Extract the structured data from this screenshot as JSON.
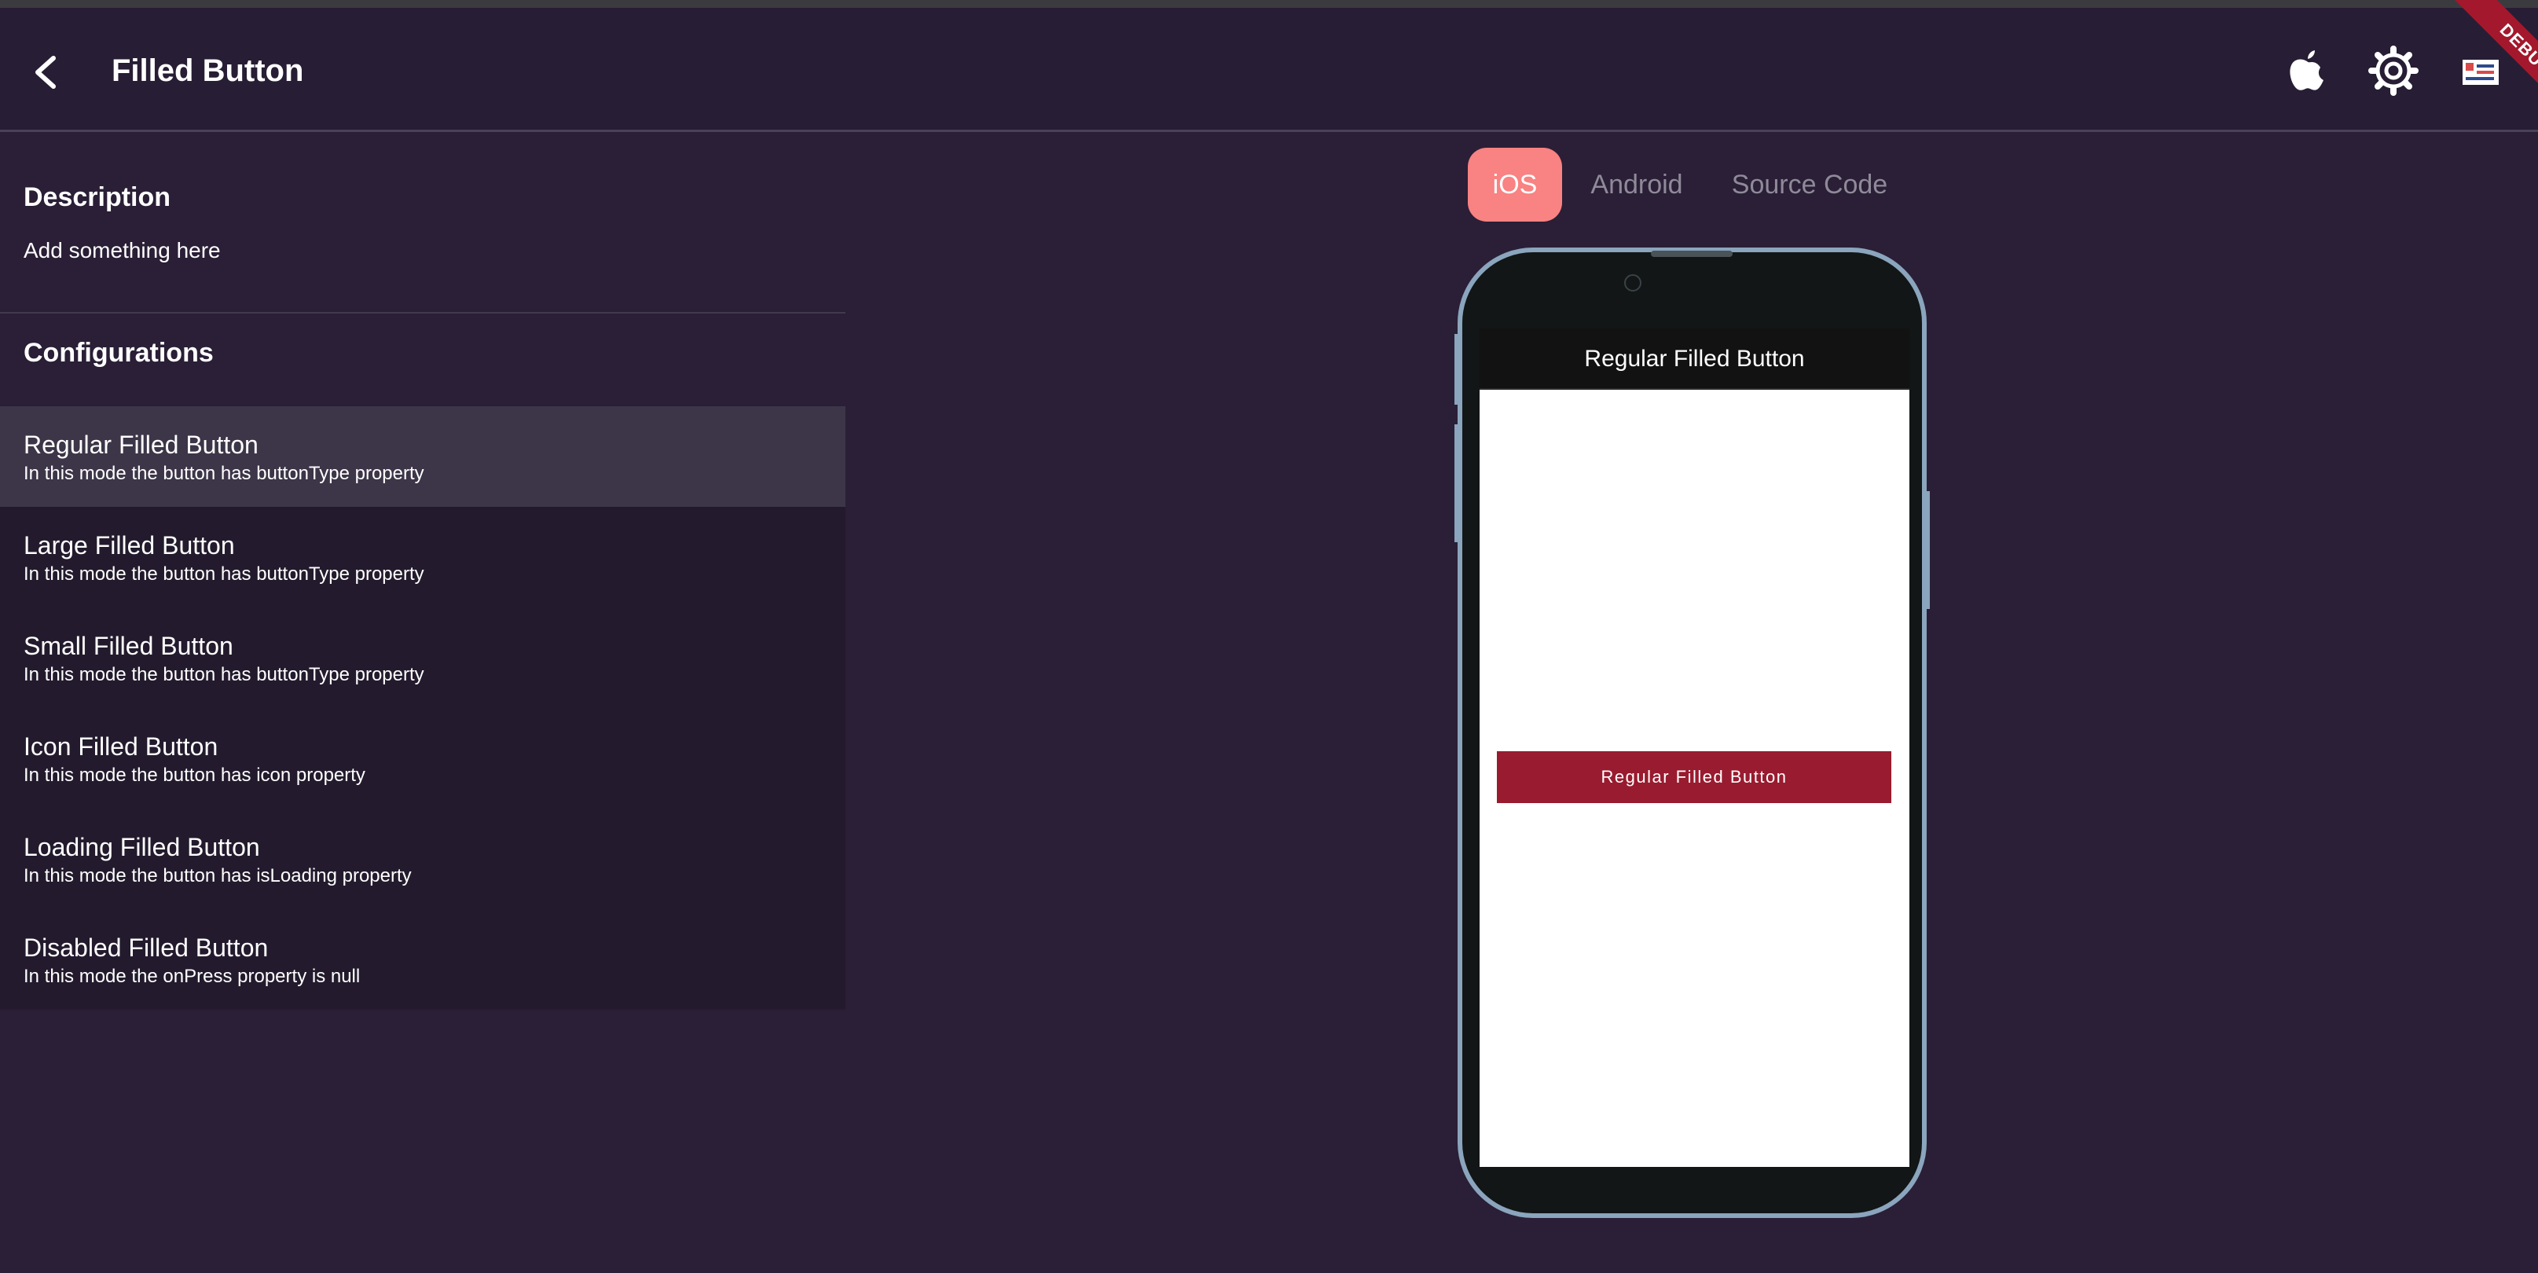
{
  "appbar": {
    "title": "Filled Button",
    "debug_label": "DEBUG",
    "icons": [
      "chevron-left-icon",
      "apple-icon",
      "gear-icon",
      "locale-flag-icon"
    ]
  },
  "description": {
    "heading": "Description",
    "text": "Add something here"
  },
  "configurations": {
    "heading": "Configurations",
    "items": [
      {
        "title": "Regular Filled Button",
        "subtitle": "In this mode the button has buttonType property",
        "selected": true
      },
      {
        "title": "Large Filled Button",
        "subtitle": "In this mode the button has buttonType property",
        "selected": false
      },
      {
        "title": "Small Filled Button",
        "subtitle": "In this mode the button has buttonType property",
        "selected": false
      },
      {
        "title": "Icon Filled Button",
        "subtitle": "In this mode the button has icon property",
        "selected": false
      },
      {
        "title": "Loading Filled Button",
        "subtitle": "In this mode the button has isLoading property",
        "selected": false
      },
      {
        "title": "Disabled Filled Button",
        "subtitle": "In this mode the onPress property is null",
        "selected": false
      }
    ]
  },
  "tabs": [
    {
      "label": "iOS",
      "active": true
    },
    {
      "label": "Android",
      "active": false
    },
    {
      "label": "Source Code",
      "active": false
    }
  ],
  "preview": {
    "navbar_title": "Regular Filled Button",
    "button_label": "Regular Filled Button"
  },
  "colors": {
    "background": "#2a1f36",
    "tab_active": "#f98282",
    "button_fill": "#991b2f",
    "phone_frame": "#8aa5bd",
    "selected_row": "#3d3548",
    "debug_banner": "#a3182c"
  }
}
